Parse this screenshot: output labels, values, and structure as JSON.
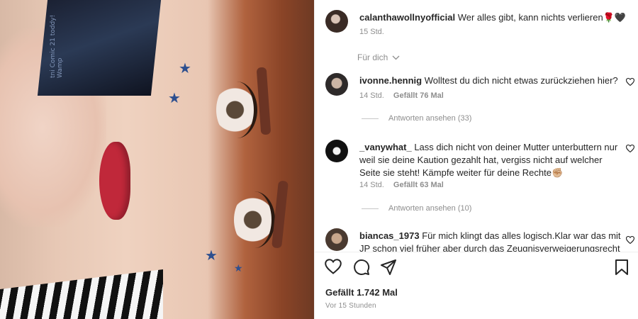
{
  "post": {
    "caption": {
      "username": "calanthawollnyofficial",
      "text": "Wer alles gibt, kann nichts verlieren🌹🖤",
      "time": "15 Std."
    },
    "for_you_label": "Für dich",
    "comments": [
      {
        "username": "ivonne.hennig",
        "text": "Wolltest du dich nicht etwas zurückziehen hier?",
        "time": "14 Std.",
        "likes": "Gefällt 76 Mal",
        "view_replies": "Antworten ansehen (33)"
      },
      {
        "username": "_vanywhat_",
        "text": "Lass dich nicht von deiner Mutter unterbuttern nur weil sie deine Kaution gezahlt hat, vergiss nicht auf welcher Seite sie steht! Kämpfe weiter für deine Rechte✊🏼",
        "time": "14 Std.",
        "likes": "Gefällt 63 Mal",
        "view_replies": "Antworten ansehen (10)"
      },
      {
        "username": "biancas_1973",
        "text": "Für mich klingt das alles logisch.Klar war das mit JP schon viel früher aber durch das Zeugnisverweigerungsrecht"
      }
    ],
    "likes_total": "Gefällt 1.742 Mal",
    "posted_ago": "Vor 15 Stunden",
    "media_overlay_text": "tni Comic 21 toddy! Wamp"
  },
  "icons": {
    "heart": "heart-icon",
    "comment": "comment-icon",
    "share": "paper-plane-icon",
    "save": "bookmark-icon",
    "chevron": "chevron-down-icon"
  },
  "colors": {
    "text": "#262626",
    "muted": "#8e8e8e",
    "lips": "#c0283a",
    "stars": "#2d4f8f"
  }
}
